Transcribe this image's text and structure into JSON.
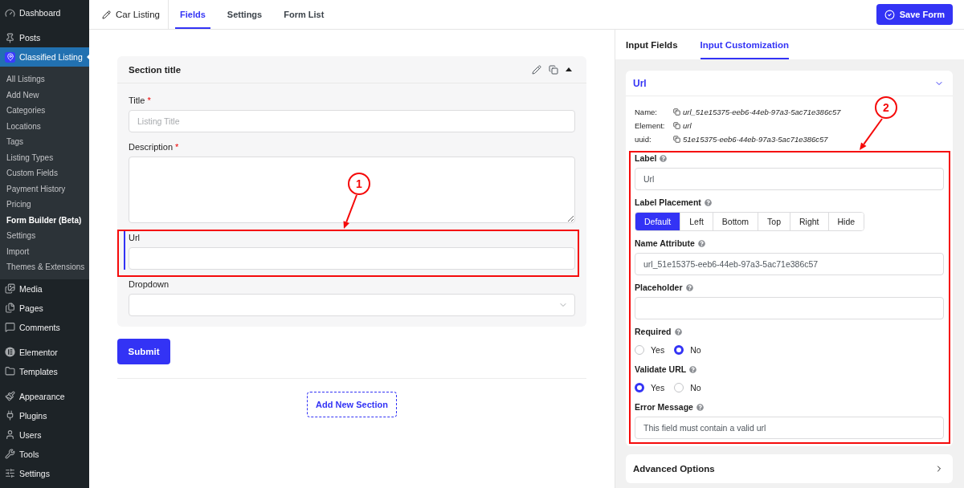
{
  "sidebar": {
    "groups": [
      [
        {
          "label": "Dashboard",
          "selected": false
        }
      ],
      [
        {
          "label": "Posts",
          "selected": false
        },
        {
          "label": "Classified Listing",
          "selected": true,
          "children": [
            {
              "label": "All Listings",
              "selected": false
            },
            {
              "label": "Add New",
              "selected": false
            },
            {
              "label": "Categories",
              "selected": false
            },
            {
              "label": "Locations",
              "selected": false
            },
            {
              "label": "Tags",
              "selected": false
            },
            {
              "label": "Listing Types",
              "selected": false
            },
            {
              "label": "Custom Fields",
              "selected": false
            },
            {
              "label": "Payment History",
              "selected": false
            },
            {
              "label": "Pricing",
              "selected": false
            },
            {
              "label": "Form Builder (Beta)",
              "selected": true
            },
            {
              "label": "Settings",
              "selected": false
            },
            {
              "label": "Import",
              "selected": false
            },
            {
              "label": "Themes & Extensions",
              "selected": false
            }
          ]
        },
        {
          "label": "Media",
          "selected": false
        },
        {
          "label": "Pages",
          "selected": false
        },
        {
          "label": "Comments",
          "selected": false
        }
      ],
      [
        {
          "label": "Elementor",
          "selected": false
        },
        {
          "label": "Templates",
          "selected": false
        }
      ],
      [
        {
          "label": "Appearance",
          "selected": false
        },
        {
          "label": "Plugins",
          "selected": false
        },
        {
          "label": "Users",
          "selected": false
        },
        {
          "label": "Tools",
          "selected": false
        },
        {
          "label": "Settings",
          "selected": false
        }
      ]
    ]
  },
  "topbar": {
    "form_name": "Car Listing",
    "tabs": [
      {
        "label": "Fields",
        "selected": true
      },
      {
        "label": "Settings",
        "selected": false
      },
      {
        "label": "Form List",
        "selected": false
      }
    ],
    "save_button": "Save Form"
  },
  "form": {
    "section": {
      "title": "Section title",
      "expanded": true,
      "fields": [
        {
          "kind": "text",
          "label": "Title",
          "required_mark": "*",
          "placeholder": "Listing Title",
          "active": false
        },
        {
          "kind": "textarea",
          "label": "Description",
          "required_mark": "*",
          "active": false
        },
        {
          "kind": "text",
          "label": "Url",
          "active": true,
          "annotation": "1"
        },
        {
          "kind": "select",
          "label": "Dropdown",
          "active": false
        }
      ]
    },
    "submit": "Submit",
    "add_section": "Add New Section"
  },
  "panel": {
    "tabs": [
      {
        "label": "Input Fields",
        "selected": false
      },
      {
        "label": "Input Customization",
        "selected": true
      }
    ],
    "field_card": {
      "title": "Url",
      "expanded": true,
      "meta": [
        {
          "key": "Name:",
          "value": "url_51e15375-eeb6-44eb-97a3-5ac71e386c57"
        },
        {
          "key": "Element:",
          "value": "url"
        },
        {
          "key": "uuid:",
          "value": "51e15375-eeb6-44eb-97a3-5ac71e386c57"
        }
      ],
      "annotation": "2",
      "settings": [
        {
          "kind": "text",
          "label": "Label",
          "value": "Url"
        },
        {
          "kind": "segmented",
          "label": "Label Placement",
          "options": [
            {
              "label": "Default",
              "selected": true
            },
            {
              "label": "Left",
              "selected": false
            },
            {
              "label": "Bottom",
              "selected": false
            },
            {
              "label": "Top",
              "selected": false
            },
            {
              "label": "Right",
              "selected": false
            },
            {
              "label": "Hide",
              "selected": false
            }
          ]
        },
        {
          "kind": "text",
          "label": "Name Attribute",
          "value": "url_51e15375-eeb6-44eb-97a3-5ac71e386c57"
        },
        {
          "kind": "text",
          "label": "Placeholder"
        },
        {
          "kind": "radio",
          "label": "Required",
          "options": [
            {
              "label": "Yes",
              "selected": false
            },
            {
              "label": "No",
              "selected": true
            }
          ]
        },
        {
          "kind": "radio",
          "label": "Validate URL",
          "options": [
            {
              "label": "Yes",
              "selected": true
            },
            {
              "label": "No",
              "selected": false
            }
          ]
        },
        {
          "kind": "text",
          "label": "Error Message",
          "value": "This field must contain a valid url"
        }
      ]
    },
    "advanced": {
      "title": "Advanced Options",
      "expanded": false
    }
  }
}
